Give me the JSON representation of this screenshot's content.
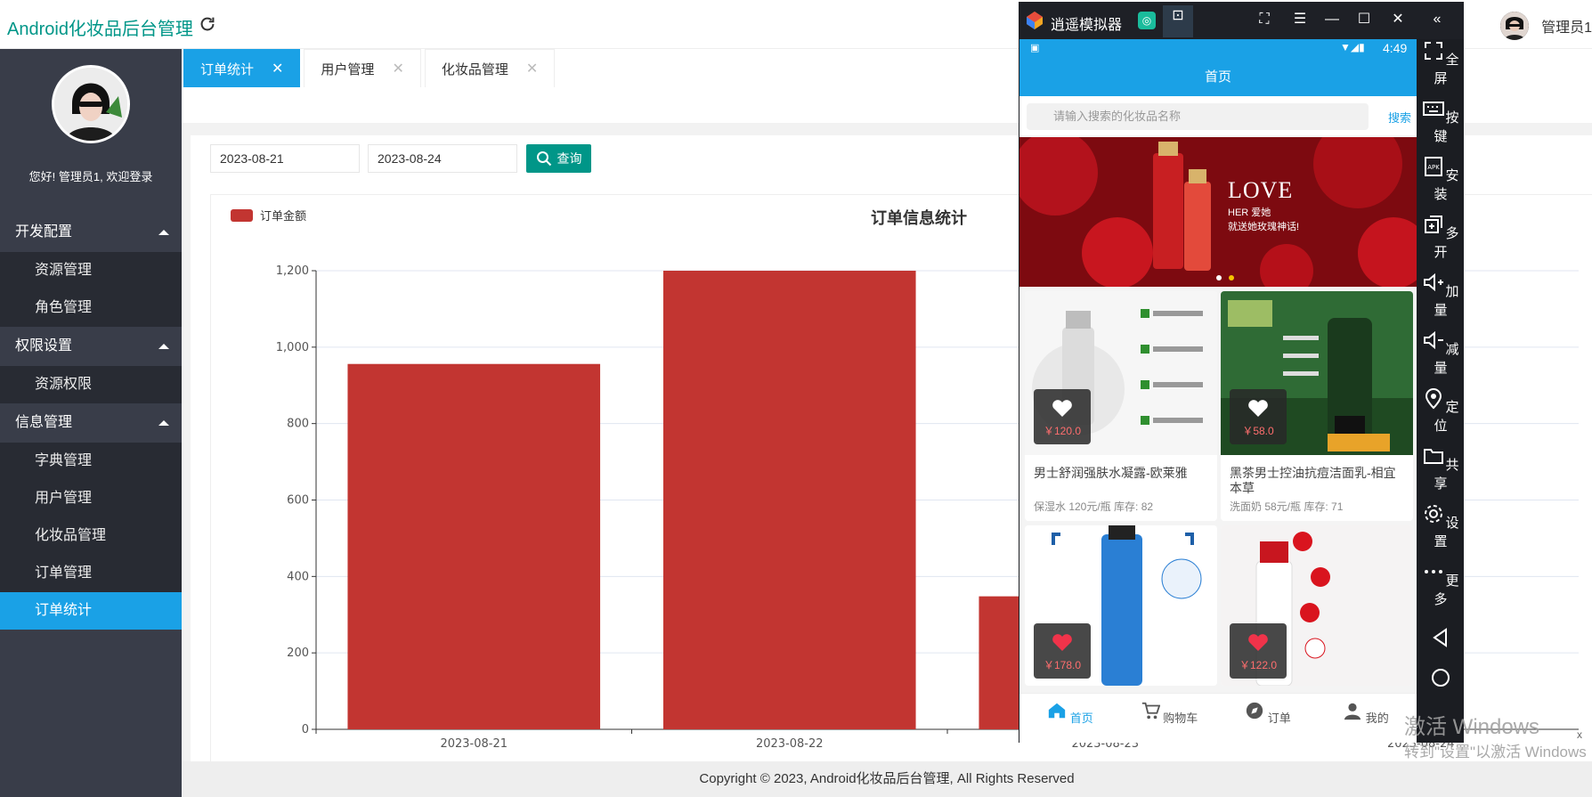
{
  "header": {
    "title": "Android化妆品后台管理",
    "user_name": "管理员1"
  },
  "sidebar": {
    "greeting": "您好! 管理员1, 欢迎登录",
    "groups": [
      {
        "label": "开发配置",
        "items": [
          "资源管理",
          "角色管理"
        ]
      },
      {
        "label": "权限设置",
        "items": [
          "资源权限"
        ]
      },
      {
        "label": "信息管理",
        "items": [
          "字典管理",
          "用户管理",
          "化妆品管理",
          "订单管理",
          "订单统计"
        ]
      }
    ],
    "active_item": "订单统计"
  },
  "tabs": [
    {
      "label": "订单统计",
      "active": true
    },
    {
      "label": "用户管理",
      "active": false
    },
    {
      "label": "化妆品管理",
      "active": false
    }
  ],
  "filter": {
    "start_date": "2023-08-21",
    "end_date": "2023-08-24",
    "query_label": "查询"
  },
  "chart_data": {
    "type": "bar",
    "title": "订单信息统计",
    "legend": "订单金额",
    "legend_position": "top-left",
    "categories": [
      "2023-08-21",
      "2023-08-22",
      "2023-08-23",
      "2023-08-24"
    ],
    "series": [
      {
        "name": "订单金额",
        "color": "#c23531",
        "values": [
          956,
          1200,
          348,
          null
        ]
      }
    ],
    "ylim": [
      0,
      1200
    ],
    "yticks": [
      "0",
      "200",
      "400",
      "600",
      "800",
      "1,000",
      "1,200"
    ],
    "grid": true
  },
  "footer": {
    "text": "Copyright © 2023, Android化妆品后台管理, All Rights Reserved"
  },
  "emulator": {
    "title": "逍遥模拟器",
    "status_time": "4:49",
    "app_title": "首页",
    "search_placeholder": "请输入搜索的化妆品名称",
    "search_button": "搜索",
    "banner": {
      "line1": "LOVE",
      "line2": "HER 爱她",
      "line3": "就送她玫瑰神话!"
    },
    "products": [
      {
        "name": "男士舒润强肤水凝露-欧莱雅",
        "price": "￥120.0",
        "meta": "保湿水  120元/瓶 库存: 82",
        "liked": false
      },
      {
        "name": "黑茶男士控油抗痘洁面乳-相宜本草",
        "price": "￥58.0",
        "meta": "洗面奶  58元/瓶 库存: 71",
        "liked": false
      },
      {
        "name": "",
        "price": "￥178.0",
        "meta": "",
        "liked": true
      },
      {
        "name": "",
        "price": "￥122.0",
        "meta": "",
        "liked": true
      }
    ],
    "nav": [
      "首页",
      "购物车",
      "订单",
      "我的"
    ],
    "side_tools": [
      "全屏",
      "按键",
      "安装",
      "多开",
      "加量",
      "减量",
      "定位",
      "共享",
      "设置",
      "更多"
    ]
  },
  "watermark": {
    "line1": "激活 Windows",
    "line2": "转到\"设置\"以激活 Windows"
  },
  "colors": {
    "accent": "#1aa1e6",
    "primary": "#009688",
    "sidebar": "#393d49",
    "bar": "#c23531"
  }
}
